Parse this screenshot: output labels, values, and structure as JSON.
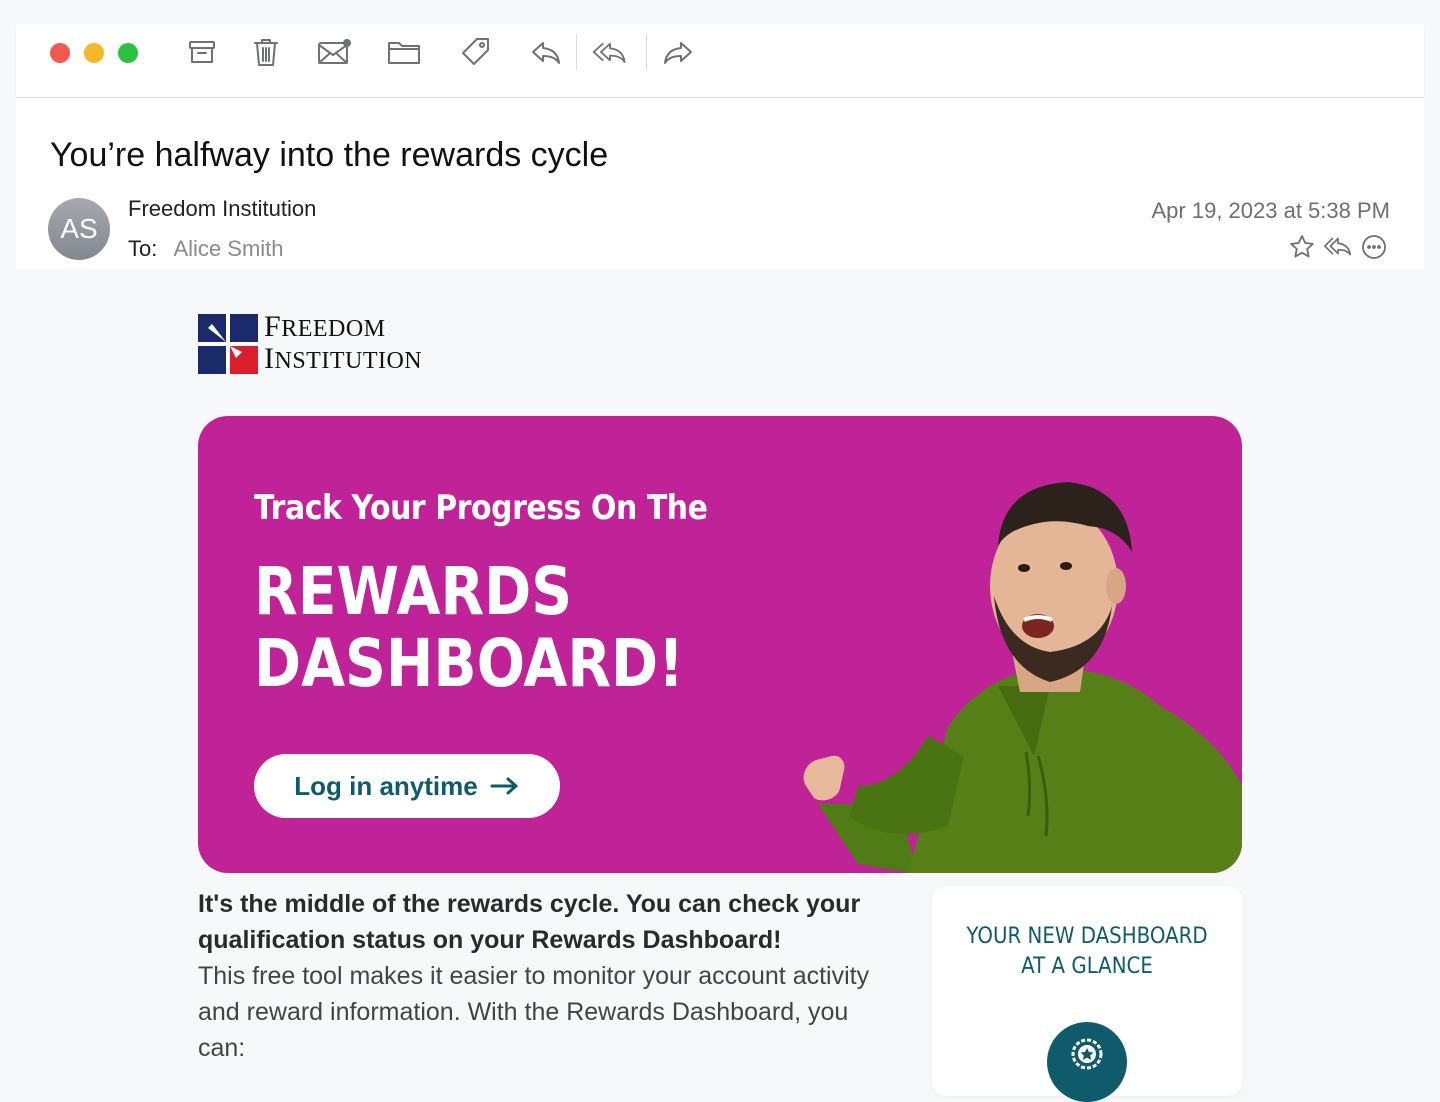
{
  "toolbar": {
    "icons": [
      "archive-icon",
      "trash-icon",
      "mark-unread-icon",
      "move-folder-icon",
      "tag-icon",
      "reply-icon",
      "reply-all-icon",
      "forward-icon"
    ]
  },
  "email": {
    "subject": "You’re halfway into the rewards cycle",
    "avatar_initials": "AS",
    "sender": "Freedom Institution",
    "to_label": "To:",
    "to_name": "Alice Smith",
    "date": "Apr 19, 2023 at 5:38 PM"
  },
  "logo": {
    "line1_cap": "F",
    "line1_rest": "REEDOM",
    "line2_cap": "I",
    "line2_rest": "NSTITUTION",
    "colors": {
      "navy": "#1b2a6b",
      "red": "#d81f2a"
    }
  },
  "hero": {
    "kicker": "Track Your Progress On The",
    "title_line1": "REWARDS",
    "title_line2": "DASHBOARD!",
    "button_label": "Log in anytime",
    "background_color": "#c02397"
  },
  "body": {
    "bold_text": "It's the middle of the rewards cycle. You can check your qualification status on your Rewards Dashboard!",
    "regular_text": "This free tool makes it easier to monitor your account activity and reward information. With the Rewards Dashboard, you can:"
  },
  "card": {
    "title_line1": "YOUR NEW DASHBOARD",
    "title_line2": "AT A GLANCE",
    "badge_icon": "award-badge-icon"
  }
}
